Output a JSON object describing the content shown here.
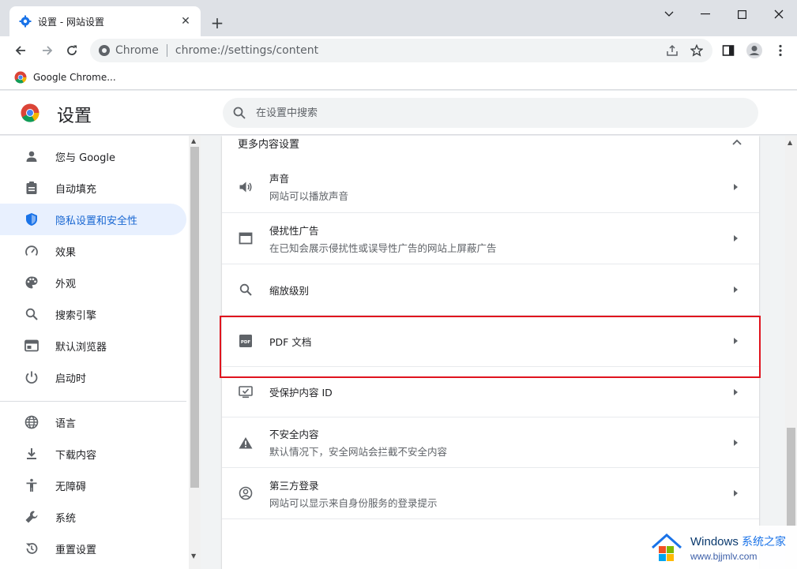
{
  "window": {
    "tab_title": "设置 - 网站设置",
    "tab_close": "✕",
    "new_tab": "+"
  },
  "toolbar": {
    "chip": "Chrome",
    "url": "chrome://settings/content"
  },
  "bookmarks": [
    {
      "label": "Google Chrome..."
    }
  ],
  "header": {
    "title": "设置",
    "search_placeholder": "在设置中搜索"
  },
  "sidebar": {
    "items": [
      {
        "label": "您与 Google",
        "icon": "person-icon"
      },
      {
        "label": "自动填充",
        "icon": "clipboard-icon"
      },
      {
        "label": "隐私设置和安全性",
        "icon": "shield-icon",
        "active": true
      },
      {
        "label": "效果",
        "icon": "speedometer-icon"
      },
      {
        "label": "外观",
        "icon": "palette-icon"
      },
      {
        "label": "搜索引擎",
        "icon": "search-icon"
      },
      {
        "label": "默认浏览器",
        "icon": "browser-icon"
      },
      {
        "label": "启动时",
        "icon": "power-icon"
      },
      {
        "label": "语言",
        "icon": "globe-icon"
      },
      {
        "label": "下载内容",
        "icon": "download-icon"
      },
      {
        "label": "无障碍",
        "icon": "accessibility-icon"
      },
      {
        "label": "系统",
        "icon": "wrench-icon"
      },
      {
        "label": "重置设置",
        "icon": "reset-icon"
      }
    ]
  },
  "content": {
    "section_title": "更多内容设置",
    "rows": [
      {
        "title": "声音",
        "subtitle": "网站可以播放声音",
        "icon": "speaker-icon"
      },
      {
        "title": "侵扰性广告",
        "subtitle": "在已知会展示侵扰性或误导性广告的网站上屏蔽广告",
        "icon": "window-icon"
      },
      {
        "title": "缩放级别",
        "subtitle": "",
        "icon": "zoom-icon"
      },
      {
        "title": "PDF 文档",
        "subtitle": "",
        "icon": "pdf-icon"
      },
      {
        "title": "受保护内容 ID",
        "subtitle": "",
        "icon": "protected-content-icon"
      },
      {
        "title": "不安全内容",
        "subtitle": "默认情况下，安全网站会拦截不安全内容",
        "icon": "warning-icon"
      },
      {
        "title": "第三方登录",
        "subtitle": "网站可以显示来自身份服务的登录提示",
        "icon": "account-circle-icon"
      }
    ]
  },
  "watermark": {
    "line1": "Windows",
    "line1_cn": "系统之家",
    "line2": "www.bjjmlv.com"
  },
  "colors": {
    "accent": "#1a73e8",
    "active_bg": "#e8f0fe",
    "highlight_border": "#e0141e"
  }
}
